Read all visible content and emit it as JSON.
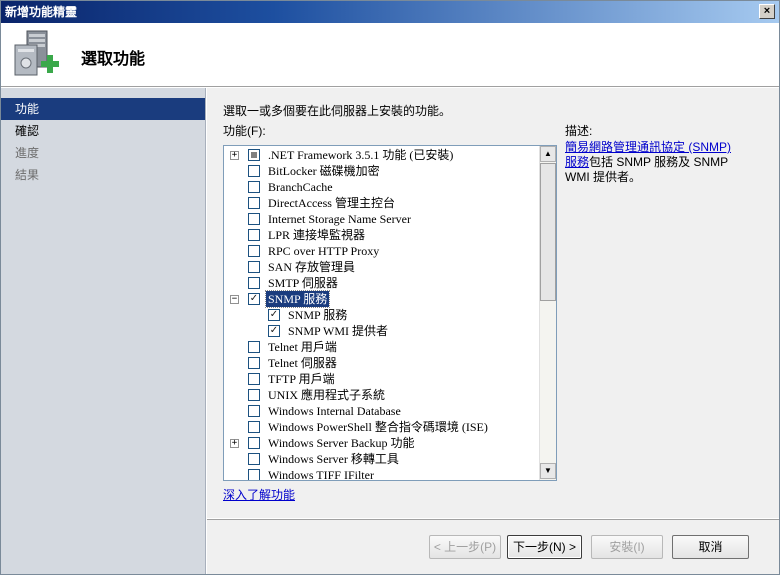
{
  "window": {
    "title": "新增功能精靈",
    "close": "×"
  },
  "header": {
    "title": "選取功能"
  },
  "nav": {
    "items": [
      {
        "label": "功能"
      },
      {
        "label": "確認"
      },
      {
        "label": "進度"
      },
      {
        "label": "結果"
      }
    ]
  },
  "main": {
    "instruction": "選取一或多個要在此伺服器上安裝的功能。",
    "features_label": "功能(F):",
    "description_label": "描述:",
    "description_link": "簡易網路管理通訊協定 (SNMP) 服務",
    "description_text": "包括 SNMP 服務及 SNMP WMI 提供者。",
    "learn_more": "深入了解功能"
  },
  "features": [
    {
      "label": ".NET Framework 3.5.1 功能  (已安裝)",
      "expander": "+",
      "check": "partial",
      "indent": 0
    },
    {
      "label": "BitLocker 磁碟機加密",
      "expander": "",
      "check": "off",
      "indent": 0
    },
    {
      "label": "BranchCache",
      "expander": "",
      "check": "off",
      "indent": 0
    },
    {
      "label": "DirectAccess 管理主控台",
      "expander": "",
      "check": "off",
      "indent": 0
    },
    {
      "label": "Internet Storage Name Server",
      "expander": "",
      "check": "off",
      "indent": 0
    },
    {
      "label": "LPR 連接埠監視器",
      "expander": "",
      "check": "off",
      "indent": 0
    },
    {
      "label": "RPC over HTTP Proxy",
      "expander": "",
      "check": "off",
      "indent": 0
    },
    {
      "label": "SAN 存放管理員",
      "expander": "",
      "check": "off",
      "indent": 0
    },
    {
      "label": "SMTP 伺服器",
      "expander": "",
      "check": "off",
      "indent": 0
    },
    {
      "label": "SNMP 服務",
      "expander": "−",
      "check": "on",
      "indent": 0,
      "selected": true
    },
    {
      "label": "SNMP 服務",
      "expander": "",
      "check": "on",
      "indent": 1
    },
    {
      "label": "SNMP WMI 提供者",
      "expander": "",
      "check": "on",
      "indent": 1
    },
    {
      "label": "Telnet 用戶端",
      "expander": "",
      "check": "off",
      "indent": 0
    },
    {
      "label": "Telnet 伺服器",
      "expander": "",
      "check": "off",
      "indent": 0
    },
    {
      "label": "TFTP 用戶端",
      "expander": "",
      "check": "off",
      "indent": 0
    },
    {
      "label": "UNIX 應用程式子系統",
      "expander": "",
      "check": "off",
      "indent": 0
    },
    {
      "label": "Windows Internal Database",
      "expander": "",
      "check": "off",
      "indent": 0
    },
    {
      "label": "Windows PowerShell 整合指令碼環境 (ISE)",
      "expander": "",
      "check": "off",
      "indent": 0
    },
    {
      "label": "Windows Server Backup 功能",
      "expander": "+",
      "check": "off",
      "indent": 0
    },
    {
      "label": "Windows Server 移轉工具",
      "expander": "",
      "check": "off",
      "indent": 0
    },
    {
      "label": "Windows TIFF IFilter",
      "expander": "",
      "check": "off",
      "indent": 0
    }
  ],
  "scroll": {
    "up": "▲",
    "down": "▼"
  },
  "buttons": {
    "previous": "< 上一步(P)",
    "next": "下一步(N) >",
    "install": "安裝(I)",
    "cancel": "取消"
  }
}
